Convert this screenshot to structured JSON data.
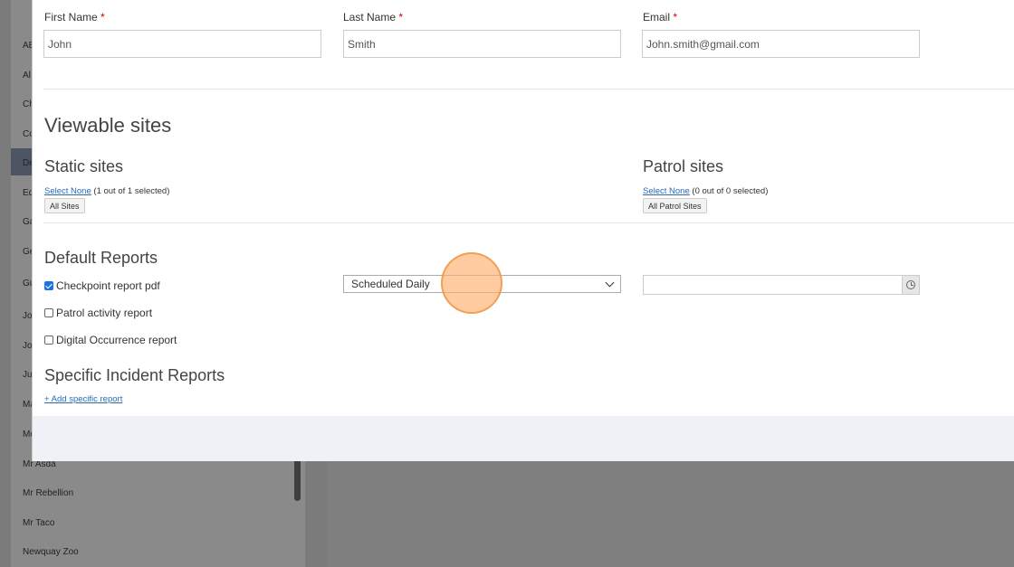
{
  "background_list": [
    "AB",
    "Al",
    "Ch",
    "Co",
    "De",
    "Ed",
    "Ga",
    "Ge",
    "Gu",
    "Jo",
    "Jo",
    "Ju",
    "Ma",
    "Mo",
    "Mr Asda",
    "Mr Rebellion",
    "Mr Taco",
    "Newquay Zoo"
  ],
  "form": {
    "first_name": {
      "label": "First Name",
      "required": "*",
      "value": "John"
    },
    "last_name": {
      "label": "Last Name",
      "required": "*",
      "value": "Smith"
    },
    "email": {
      "label": "Email",
      "required": "*",
      "value": "John.smith@gmail.com"
    }
  },
  "viewable_sites": {
    "title": "Viewable sites",
    "static": {
      "title": "Static sites",
      "select_none": "Select None",
      "count": "(1 out of 1 selected)",
      "tag": "All Sites"
    },
    "patrol": {
      "title": "Patrol sites",
      "select_none": "Select None",
      "count": "(0 out of 0 selected)",
      "tag": "All Patrol Sites"
    }
  },
  "default_reports": {
    "title": "Default Reports",
    "items": [
      {
        "label": "Checkpoint report pdf",
        "checked": true
      },
      {
        "label": "Patrol activity report",
        "checked": false
      },
      {
        "label": "Digital Occurrence report",
        "checked": false
      }
    ],
    "schedule": "Scheduled Daily"
  },
  "specific_reports": {
    "title": "Specific Incident Reports",
    "add_link": "+ Add specific report"
  },
  "colors": {
    "accent": "#1a73e8",
    "link": "#2a6ab8",
    "required": "#cc0000",
    "footer": "#eef1f5"
  }
}
